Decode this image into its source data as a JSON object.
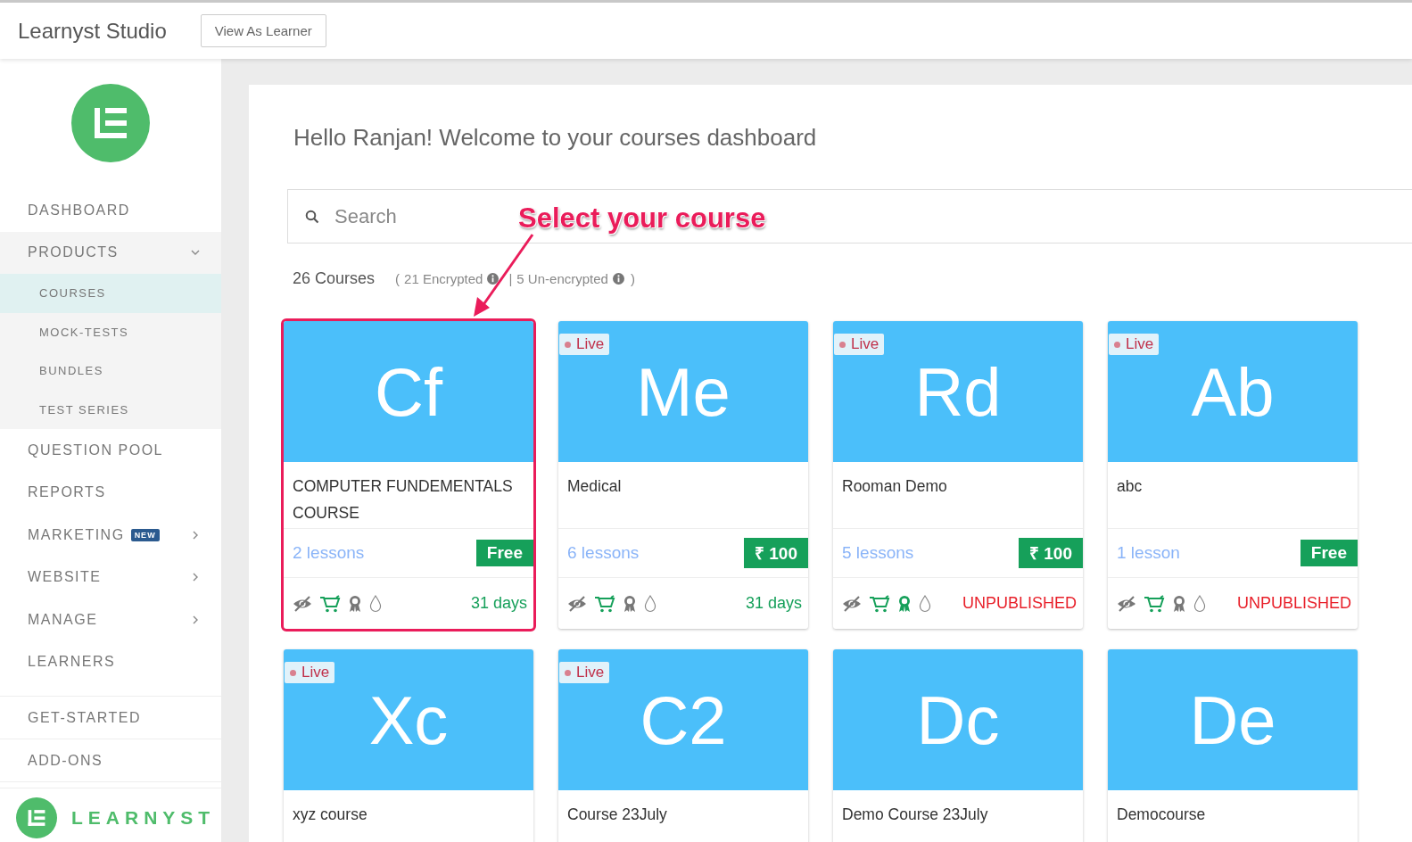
{
  "header": {
    "title": "Learnyst Studio",
    "button": "View As Learner"
  },
  "sidebar": {
    "items": [
      {
        "label": "DASHBOARD",
        "selected": false
      },
      {
        "label": "PRODUCTS",
        "selected": false,
        "expanded": true,
        "children": [
          {
            "label": "COURSES",
            "selected": true
          },
          {
            "label": "MOCK-TESTS",
            "selected": false
          },
          {
            "label": "BUNDLES",
            "selected": false
          },
          {
            "label": "TEST SERIES",
            "selected": false
          }
        ]
      },
      {
        "label": "QUESTION POOL",
        "selected": false
      },
      {
        "label": "REPORTS",
        "selected": false
      },
      {
        "label": "MARKETING",
        "selected": false,
        "badge": "NEW",
        "expanded": false
      },
      {
        "label": "WEBSITE",
        "selected": false,
        "expanded": false
      },
      {
        "label": "MANAGE",
        "selected": false,
        "expanded": false
      },
      {
        "label": "LEARNERS",
        "selected": false
      }
    ],
    "bottom_items": [
      {
        "label": "GET-STARTED"
      },
      {
        "label": "ADD-ONS"
      }
    ],
    "footer_brand": "LEARNYST"
  },
  "main": {
    "welcome": "Hello Ranjan! Welcome to your courses dashboard",
    "search": {
      "placeholder": "Search"
    },
    "summary": {
      "count": "26 Courses",
      "open": "(",
      "encrypted": "21 Encrypted",
      "separator": "|",
      "unencrypted": "5 Un-encrypted",
      "close": ")"
    },
    "annotation": {
      "text": "Select your course"
    },
    "courses": [
      {
        "initials": "Cf",
        "live": false,
        "highlighted": true,
        "title": "COMPUTER FUNDEMENTALS COURSE",
        "lessons": "2 lessons",
        "price": "Free",
        "certificate": false,
        "status": {
          "kind": "duration",
          "text": "31 days"
        }
      },
      {
        "initials": "Me",
        "live": true,
        "live_label": "Live",
        "highlighted": false,
        "title": "Medical",
        "lessons": "6 lessons",
        "price": "₹ 100",
        "certificate": false,
        "status": {
          "kind": "duration",
          "text": "31 days"
        }
      },
      {
        "initials": "Rd",
        "live": true,
        "live_label": "Live",
        "highlighted": false,
        "title": "Rooman Demo",
        "lessons": "5 lessons",
        "price": "₹ 100",
        "certificate": true,
        "status": {
          "kind": "unpublished",
          "text": "UNPUBLISHED"
        }
      },
      {
        "initials": "Ab",
        "live": true,
        "live_label": "Live",
        "highlighted": false,
        "title": "abc",
        "lessons": "1 lesson",
        "price": "Free",
        "certificate": false,
        "status": {
          "kind": "unpublished",
          "text": "UNPUBLISHED"
        }
      },
      {
        "initials": "Xc",
        "live": true,
        "live_label": "Live",
        "highlighted": false,
        "title": "xyz course"
      },
      {
        "initials": "C2",
        "live": true,
        "live_label": "Live",
        "highlighted": false,
        "title": "Course 23July"
      },
      {
        "initials": "Dc",
        "live": false,
        "highlighted": false,
        "title": "Demo Course 23July"
      },
      {
        "initials": "De",
        "live": false,
        "highlighted": false,
        "title": "Democourse"
      }
    ]
  }
}
